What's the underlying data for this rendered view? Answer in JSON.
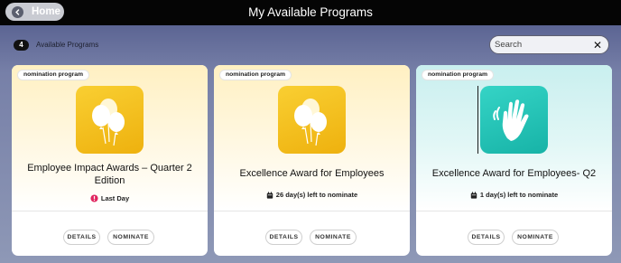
{
  "header": {
    "home_label": "Home",
    "title": "My Available Programs"
  },
  "subbar": {
    "count": "4",
    "count_label": "Available Programs",
    "search_placeholder": "Search"
  },
  "cards": [
    {
      "tag": "nomination program",
      "icon": "balloons-icon",
      "title": "Employee Impact Awards – Quarter 2 Edition",
      "status": "Last Day",
      "status_icon": "alert-icon",
      "details_label": "DETAILS",
      "nominate_label": "NOMINATE",
      "accent": "#f5c21e"
    },
    {
      "tag": "nomination program",
      "icon": "balloons-icon",
      "title": "Excellence Award for Employees",
      "status": "26 day(s) left to nominate",
      "status_icon": "calendar-icon",
      "details_label": "DETAILS",
      "nominate_label": "NOMINATE",
      "accent": "#f5c21e"
    },
    {
      "tag": "nomination program",
      "icon": "waving-hand-icon",
      "title": "Excellence Award for Employees- Q2",
      "status": "1 day(s) left to nominate",
      "status_icon": "calendar-icon",
      "details_label": "DETAILS",
      "nominate_label": "NOMINATE",
      "accent": "#22c3b6"
    }
  ],
  "colors": {
    "header_bg": "#050505",
    "alert_red": "#e0245e"
  }
}
